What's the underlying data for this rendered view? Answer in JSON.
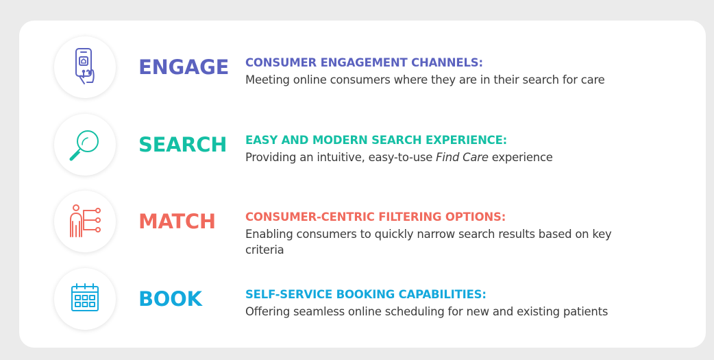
{
  "colors": {
    "background": "#ebebeb",
    "card": "#ffffff",
    "text": "#3b3b3b",
    "engage": "#5b62bf",
    "search": "#14bfa4",
    "match": "#f06a5d",
    "book": "#13a8dc"
  },
  "steps": [
    {
      "icon": "smartphone-tap-icon",
      "title": "ENGAGE",
      "heading": "CONSUMER ENGAGEMENT CHANNELS:",
      "description": "Meeting online consumers where they are in their search for care"
    },
    {
      "icon": "magnifying-glass-icon",
      "title": "SEARCH",
      "heading": "EASY AND MODERN SEARCH EXPERIENCE:",
      "description_before": "Providing an intuitive, easy-to-use ",
      "description_emphasis": "Find Care",
      "description_after": " experience"
    },
    {
      "icon": "person-filter-icon",
      "title": "MATCH",
      "heading": "CONSUMER-CENTRIC FILTERING OPTIONS:",
      "description": "Enabling consumers to quickly narrow search results based on key criteria"
    },
    {
      "icon": "calendar-icon",
      "title": "BOOK",
      "heading": "SELF-SERVICE BOOKING CAPABILITIES:",
      "description": "Offering seamless online scheduling for new and existing patients"
    }
  ]
}
